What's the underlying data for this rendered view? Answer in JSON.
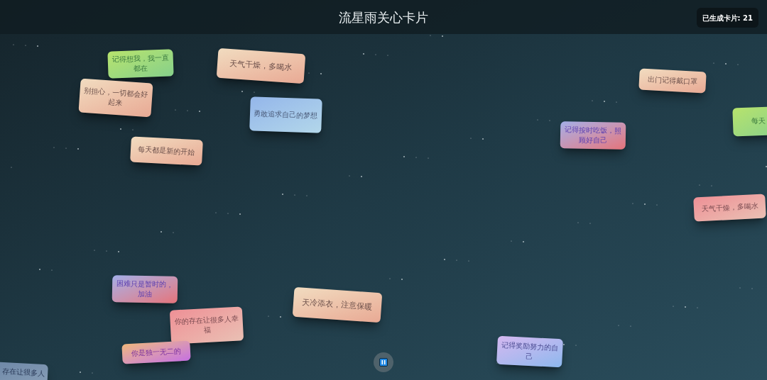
{
  "header": {
    "title": "流星雨关心卡片",
    "counter": "已生成卡片: 21"
  },
  "cards": [
    {
      "text": "记得想我，我一直都在",
      "kind": "green"
    },
    {
      "text": "天气干燥，多喝水",
      "kind": "peach"
    },
    {
      "text": "别担心，一切都会好起来",
      "kind": "peach"
    },
    {
      "text": "勇敢追求自己的梦想",
      "kind": "blue"
    },
    {
      "text": "每天都是新的开始",
      "kind": "peach"
    },
    {
      "text": "出门记得戴口罩",
      "kind": "peach"
    },
    {
      "text": "每天",
      "kind": "green"
    },
    {
      "text": "记得按时吃饭，照顾好自己",
      "kind": "violet"
    },
    {
      "text": "天气干燥，多喝水",
      "kind": "pink"
    },
    {
      "text": "困难只是暂时的，加油",
      "kind": "violet"
    },
    {
      "text": "天冷添衣，注意保暖",
      "kind": "peach"
    },
    {
      "text": "你的存在让很多人幸福",
      "kind": "pink"
    },
    {
      "text": "你是独一无二的",
      "kind": "orchid"
    },
    {
      "text": "存在让很多人",
      "kind": "slate"
    },
    {
      "text": "记得奖励努力的自己",
      "kind": "lavender"
    }
  ]
}
